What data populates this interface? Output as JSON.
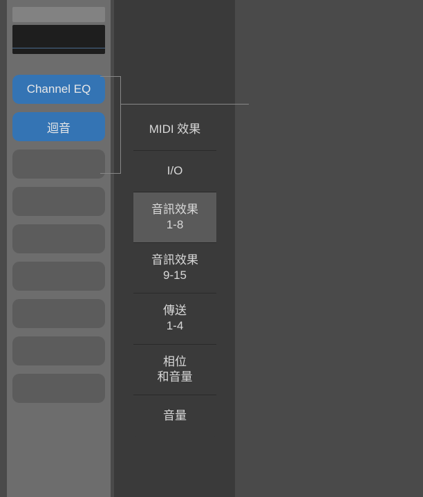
{
  "channel_strip": {
    "slots": [
      {
        "label": "Channel EQ",
        "active": true
      },
      {
        "label": "迴音",
        "active": true
      },
      {
        "label": "",
        "active": false
      },
      {
        "label": "",
        "active": false
      },
      {
        "label": "",
        "active": false
      },
      {
        "label": "",
        "active": false
      },
      {
        "label": "",
        "active": false
      },
      {
        "label": "",
        "active": false
      },
      {
        "label": "",
        "active": false
      }
    ]
  },
  "popup_menu": {
    "items": [
      {
        "label": "MIDI 效果",
        "selected": false
      },
      {
        "label": "I/O",
        "selected": false
      },
      {
        "label": "音訊效果\n1-8",
        "selected": true
      },
      {
        "label": "音訊效果\n9-15",
        "selected": false
      },
      {
        "label": "傳送\n1-4",
        "selected": false
      },
      {
        "label": "相位\n和音量",
        "selected": false
      },
      {
        "label": "音量",
        "selected": false
      }
    ]
  }
}
